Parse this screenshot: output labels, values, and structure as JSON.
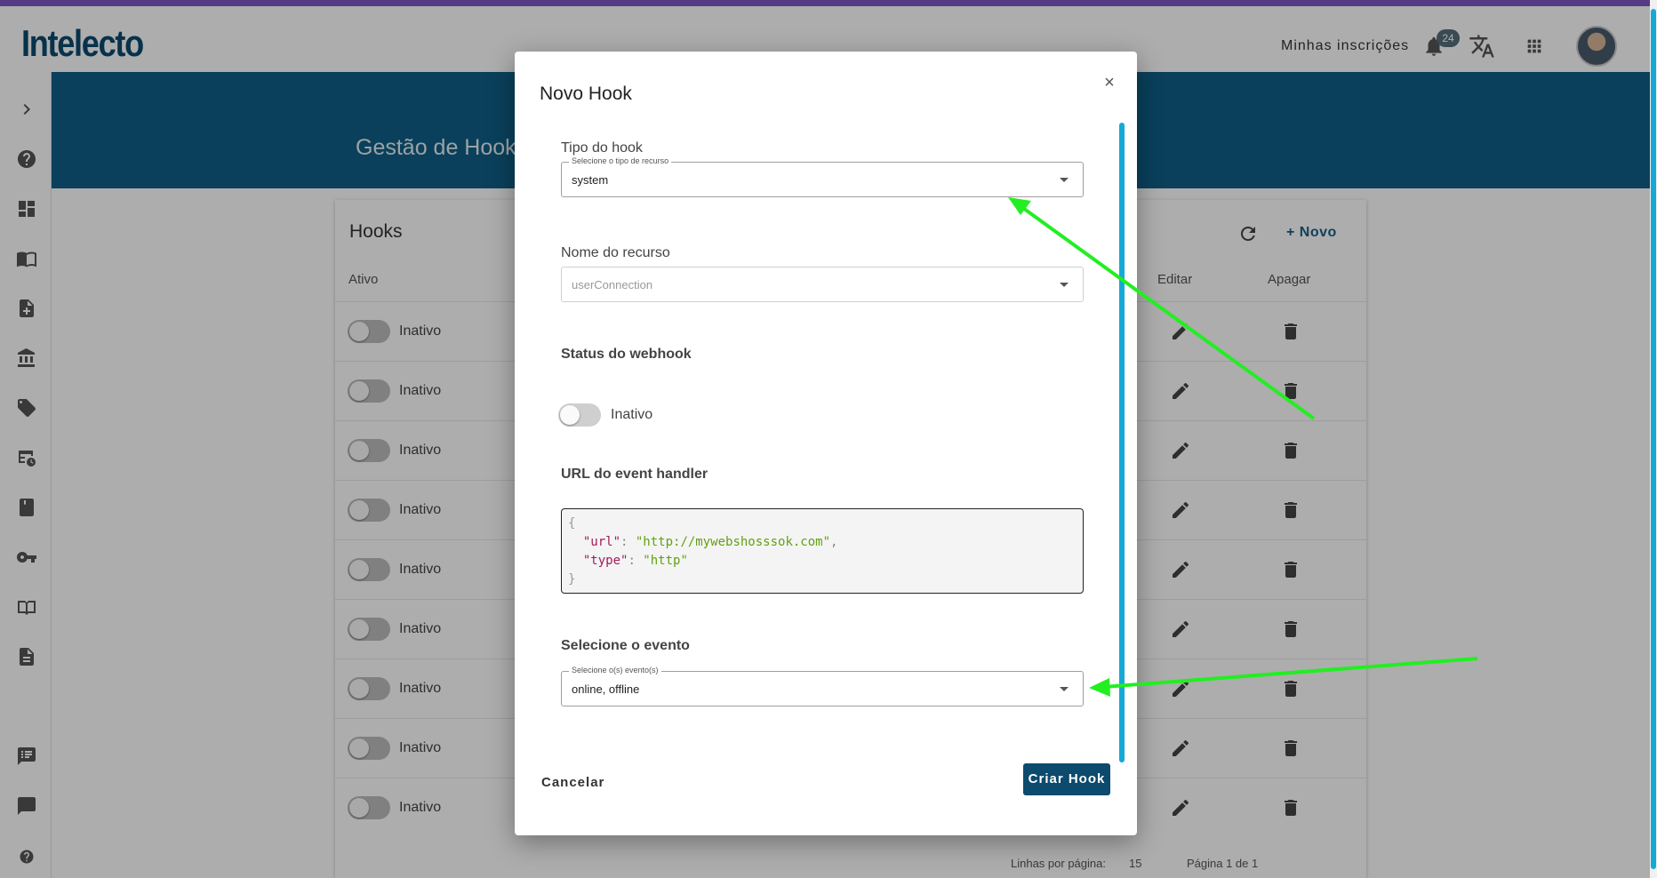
{
  "header": {
    "logo": "Intelecto",
    "my_subscriptions": "Minhas inscrições",
    "notification_count": "24"
  },
  "banner": {
    "title": "Gestão de Hooks"
  },
  "card": {
    "title": "Hooks",
    "new_label": "+ Novo",
    "columns": {
      "active": "Ativo",
      "edit": "Editar",
      "delete": "Apagar"
    },
    "rows": [
      {
        "status": "Inativo"
      },
      {
        "status": "Inativo"
      },
      {
        "status": "Inativo"
      },
      {
        "status": "Inativo"
      },
      {
        "status": "Inativo"
      },
      {
        "status": "Inativo"
      },
      {
        "status": "Inativo"
      },
      {
        "status": "Inativo"
      },
      {
        "status": "Inativo"
      }
    ],
    "footer": {
      "rows_per_page_label": "Linhas por página:",
      "rows_per_page_value": "15",
      "page_info": "Página 1 de 1"
    }
  },
  "modal": {
    "title": "Novo Hook",
    "close": "×",
    "hook_type": {
      "label": "Tipo do hook",
      "legend": "Selecione o tipo de recurso",
      "value": "system"
    },
    "resource_name": {
      "label": "Nome do recurso",
      "value": "userConnection"
    },
    "webhook_status": {
      "label": "Status do webhook",
      "value": "Inativo"
    },
    "event_handler": {
      "label": "URL do event handler",
      "open_brace": "{",
      "close_brace": "}",
      "url_key": "\"url\"",
      "url_value": "\"http://mywebshosssok.com\"",
      "type_key": "\"type\"",
      "type_value": "\"http\""
    },
    "event": {
      "label": "Selecione o evento",
      "legend": "Selecione o(s) evento(s)",
      "value": "online, offline"
    },
    "cancel_label": "Cancelar",
    "submit_label": "Criar Hook"
  },
  "colors": {
    "brand": "#0b4a6f",
    "banner": "#0f5f87",
    "accent_scroll": "#16a9d6",
    "annotation_arrow": "#22ee22",
    "top_strip": "#7e57c2"
  }
}
